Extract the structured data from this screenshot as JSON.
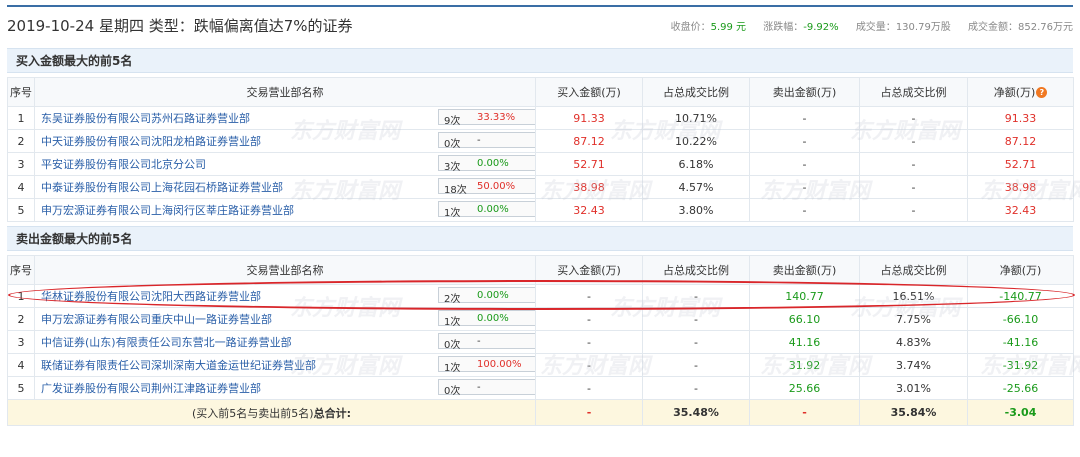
{
  "header": {
    "title": "2019-10-24 星期四 类型：跌幅偏离值达7%的证券",
    "close_label": "收盘价：",
    "close_value": "5.99 元",
    "change_label": "涨跌幅：",
    "change_value": "-9.92%",
    "volume_label": "成交量：",
    "volume_value": "130.79万股",
    "amount_label": "成交金额：",
    "amount_value": "852.76万元"
  },
  "columns": {
    "seq": "序号",
    "name": "交易营业部名称",
    "buy": "买入金额(万)",
    "buy_ratio": "占总成交比例",
    "sell": "卖出金额(万)",
    "sell_ratio": "占总成交比例",
    "net": "净额(万)"
  },
  "buy_section": {
    "title": "买入金额最大的前5名",
    "rows": [
      {
        "seq": "1",
        "name": "东吴证券股份有限公司苏州石路证券营业部",
        "count": "9次",
        "pct": "33.33%",
        "buy": "91.33",
        "buy_ratio": "10.71%",
        "sell": "-",
        "sell_ratio": "-",
        "net": "91.33"
      },
      {
        "seq": "2",
        "name": "中天证券股份有限公司沈阳龙柏路证券营业部",
        "count": "0次",
        "pct": "-",
        "buy": "87.12",
        "buy_ratio": "10.22%",
        "sell": "-",
        "sell_ratio": "-",
        "net": "87.12"
      },
      {
        "seq": "3",
        "name": "平安证券股份有限公司北京分公司",
        "count": "3次",
        "pct": "0.00%",
        "buy": "52.71",
        "buy_ratio": "6.18%",
        "sell": "-",
        "sell_ratio": "-",
        "net": "52.71"
      },
      {
        "seq": "4",
        "name": "中泰证券股份有限公司上海花园石桥路证券营业部",
        "count": "18次",
        "pct": "50.00%",
        "buy": "38.98",
        "buy_ratio": "4.57%",
        "sell": "-",
        "sell_ratio": "-",
        "net": "38.98"
      },
      {
        "seq": "5",
        "name": "申万宏源证券有限公司上海闵行区莘庄路证券营业部",
        "count": "1次",
        "pct": "0.00%",
        "buy": "32.43",
        "buy_ratio": "3.80%",
        "sell": "-",
        "sell_ratio": "-",
        "net": "32.43"
      }
    ]
  },
  "sell_section": {
    "title": "卖出金额最大的前5名",
    "rows": [
      {
        "seq": "1",
        "name": "华林证券股份有限公司沈阳大西路证券营业部",
        "count": "2次",
        "pct": "0.00%",
        "buy": "-",
        "buy_ratio": "-",
        "sell": "140.77",
        "sell_ratio": "16.51%",
        "net": "-140.77"
      },
      {
        "seq": "2",
        "name": "申万宏源证券有限公司重庆中山一路证券营业部",
        "count": "1次",
        "pct": "0.00%",
        "buy": "-",
        "buy_ratio": "-",
        "sell": "66.10",
        "sell_ratio": "7.75%",
        "net": "-66.10"
      },
      {
        "seq": "3",
        "name": "中信证券(山东)有限责任公司东营北一路证券营业部",
        "count": "0次",
        "pct": "-",
        "buy": "-",
        "buy_ratio": "-",
        "sell": "41.16",
        "sell_ratio": "4.83%",
        "net": "-41.16"
      },
      {
        "seq": "4",
        "name": "联储证券有限责任公司深圳深南大道金运世纪证券营业部",
        "count": "1次",
        "pct": "100.00%",
        "buy": "-",
        "buy_ratio": "-",
        "sell": "31.92",
        "sell_ratio": "3.74%",
        "net": "-31.92"
      },
      {
        "seq": "5",
        "name": "广发证券股份有限公司荆州江津路证券营业部",
        "count": "0次",
        "pct": "-",
        "buy": "-",
        "buy_ratio": "-",
        "sell": "25.66",
        "sell_ratio": "3.01%",
        "net": "-25.66"
      }
    ]
  },
  "total": {
    "label_prefix": "(买入前5名与卖出前5名)",
    "label_bold": "总合计:",
    "buy": "-",
    "buy_ratio": "35.48%",
    "sell": "-",
    "sell_ratio": "35.84%",
    "net": "-3.04"
  },
  "watermark_text": "东方财富网",
  "colors": {
    "up": "#e0302a",
    "down": "#1a9a1a",
    "link": "#2a5fa8",
    "accent": "#3a6ea5"
  }
}
